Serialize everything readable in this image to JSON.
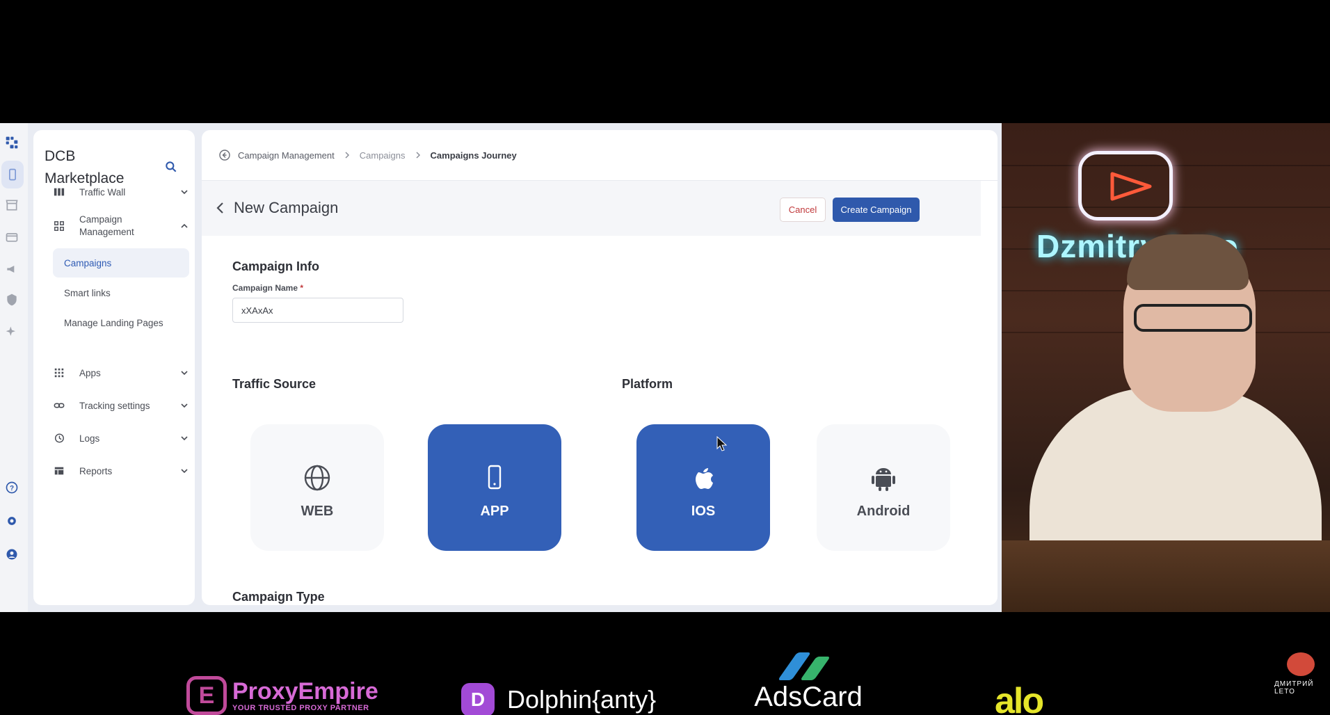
{
  "sidebar": {
    "brand": "DCB Marketplace",
    "items": [
      {
        "label": "Traffic Wall"
      },
      {
        "label": "Campaign Management"
      },
      {
        "label": "Apps"
      },
      {
        "label": "Tracking settings"
      },
      {
        "label": "Logs"
      },
      {
        "label": "Reports"
      }
    ],
    "sub_items": [
      {
        "label": "Campaigns",
        "active": true
      },
      {
        "label": "Smart links"
      },
      {
        "label": "Manage Landing Pages"
      }
    ]
  },
  "breadcrumb": {
    "items": [
      "Campaign Management",
      "Campaigns",
      "Campaigns Journey"
    ]
  },
  "header": {
    "title": "New Campaign",
    "cancel_label": "Cancel",
    "create_label": "Create Campaign"
  },
  "form": {
    "section_info": "Campaign Info",
    "name_label": "Campaign Name",
    "required_mark": "*",
    "name_value": "xXAxAx",
    "section_traffic": "Traffic Source",
    "section_platform": "Platform",
    "section_type": "Campaign Type",
    "traffic_options": [
      {
        "label": "WEB",
        "selected": false,
        "icon": "globe-icon"
      },
      {
        "label": "APP",
        "selected": true,
        "icon": "phone-icon"
      }
    ],
    "platform_options": [
      {
        "label": "IOS",
        "selected": true,
        "icon": "apple-icon"
      },
      {
        "label": "Android",
        "selected": false,
        "icon": "android-icon"
      }
    ]
  },
  "webcam": {
    "neon_text": "Dzmitry Leto"
  },
  "sponsors": {
    "proxy_badge": "E",
    "proxy_name": "ProxyEmpire",
    "proxy_tagline": "YOUR TRUSTED PROXY PARTNER",
    "dolphin_badge": "D",
    "dolphin_name": "Dolphin{anty}",
    "adscard_name": "AdsCard",
    "alo_name": "alo",
    "corner_name": "ДМИТРИЙ LETO"
  },
  "colors": {
    "accent": "#2f59ac",
    "tile_selected": "#3360b7",
    "danger": "#c0393b"
  }
}
